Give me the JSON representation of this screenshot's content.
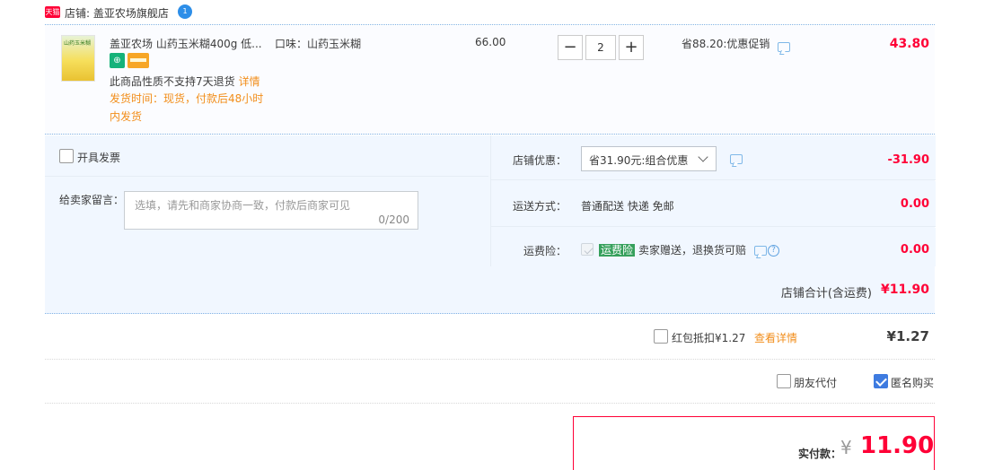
{
  "store": {
    "tmall_badge": "天猫",
    "label": "店铺: 盖亚农场旗舰店",
    "wangwang_badge": "1"
  },
  "item": {
    "thumb_text": "山药玉米糊",
    "title": "盖亚农场 山药玉米糊400g 低...",
    "badge_icons": [
      "guarantee-icon",
      "card-icon"
    ],
    "note": "此商品性质不支持7天退货",
    "note_link": "详情",
    "ship_time": "发货时间：现货，付款后48小时内发货",
    "sku": "口味：山药玉米糊",
    "unit_price": "66.00",
    "qty_minus": "−",
    "quantity": "2",
    "qty_plus": "+",
    "promo": "省88.20:优惠促销",
    "total": "43.80"
  },
  "options": {
    "invoice_label": "开具发票",
    "memo_label": "给卖家留言：",
    "memo_placeholder": "选填，请先和商家协商一致，付款后商家可见",
    "memo_count": "0/200",
    "discount_label": "店铺优惠：",
    "discount_selected": "省31.90元:组合优惠",
    "discount_amount": "-31.90",
    "shipping_label": "运送方式：",
    "shipping_value": "普通配送 快递 免邮",
    "shipping_amount": "0.00",
    "insurance_label": "运费险：",
    "insurance_tag": "运费险",
    "insurance_text": "卖家赠送，退换货可赔",
    "insurance_help": "?",
    "insurance_amount": "0.00",
    "store_total_label": "店铺合计(含运费)",
    "store_total": "¥11.90"
  },
  "hongbao": {
    "label": "红包抵扣¥1.27",
    "link": "查看详情",
    "value": "¥1.27"
  },
  "pay_options": {
    "friend_pay": "朋友代付",
    "anonymous": "匿名购买"
  },
  "actual_pay": {
    "label": "实付款：",
    "yen": "¥",
    "value": "11.90"
  },
  "colors": {
    "price_red": "#ff0036",
    "link_orange": "#f28e1b",
    "section_blue": "#f1f7ff",
    "check_blue": "#3e7be0"
  }
}
